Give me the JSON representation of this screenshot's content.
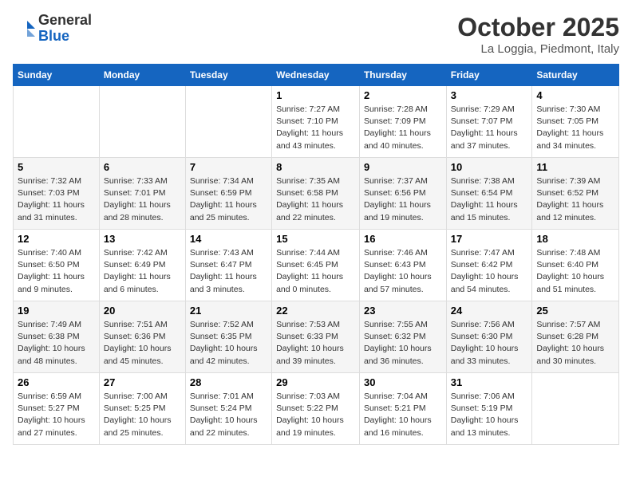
{
  "header": {
    "logo_general": "General",
    "logo_blue": "Blue",
    "month_title": "October 2025",
    "location": "La Loggia, Piedmont, Italy"
  },
  "weekdays": [
    "Sunday",
    "Monday",
    "Tuesday",
    "Wednesday",
    "Thursday",
    "Friday",
    "Saturday"
  ],
  "weeks": [
    [
      {
        "day": "",
        "text": ""
      },
      {
        "day": "",
        "text": ""
      },
      {
        "day": "",
        "text": ""
      },
      {
        "day": "1",
        "text": "Sunrise: 7:27 AM\nSunset: 7:10 PM\nDaylight: 11 hours and 43 minutes."
      },
      {
        "day": "2",
        "text": "Sunrise: 7:28 AM\nSunset: 7:09 PM\nDaylight: 11 hours and 40 minutes."
      },
      {
        "day": "3",
        "text": "Sunrise: 7:29 AM\nSunset: 7:07 PM\nDaylight: 11 hours and 37 minutes."
      },
      {
        "day": "4",
        "text": "Sunrise: 7:30 AM\nSunset: 7:05 PM\nDaylight: 11 hours and 34 minutes."
      }
    ],
    [
      {
        "day": "5",
        "text": "Sunrise: 7:32 AM\nSunset: 7:03 PM\nDaylight: 11 hours and 31 minutes."
      },
      {
        "day": "6",
        "text": "Sunrise: 7:33 AM\nSunset: 7:01 PM\nDaylight: 11 hours and 28 minutes."
      },
      {
        "day": "7",
        "text": "Sunrise: 7:34 AM\nSunset: 6:59 PM\nDaylight: 11 hours and 25 minutes."
      },
      {
        "day": "8",
        "text": "Sunrise: 7:35 AM\nSunset: 6:58 PM\nDaylight: 11 hours and 22 minutes."
      },
      {
        "day": "9",
        "text": "Sunrise: 7:37 AM\nSunset: 6:56 PM\nDaylight: 11 hours and 19 minutes."
      },
      {
        "day": "10",
        "text": "Sunrise: 7:38 AM\nSunset: 6:54 PM\nDaylight: 11 hours and 15 minutes."
      },
      {
        "day": "11",
        "text": "Sunrise: 7:39 AM\nSunset: 6:52 PM\nDaylight: 11 hours and 12 minutes."
      }
    ],
    [
      {
        "day": "12",
        "text": "Sunrise: 7:40 AM\nSunset: 6:50 PM\nDaylight: 11 hours and 9 minutes."
      },
      {
        "day": "13",
        "text": "Sunrise: 7:42 AM\nSunset: 6:49 PM\nDaylight: 11 hours and 6 minutes."
      },
      {
        "day": "14",
        "text": "Sunrise: 7:43 AM\nSunset: 6:47 PM\nDaylight: 11 hours and 3 minutes."
      },
      {
        "day": "15",
        "text": "Sunrise: 7:44 AM\nSunset: 6:45 PM\nDaylight: 11 hours and 0 minutes."
      },
      {
        "day": "16",
        "text": "Sunrise: 7:46 AM\nSunset: 6:43 PM\nDaylight: 10 hours and 57 minutes."
      },
      {
        "day": "17",
        "text": "Sunrise: 7:47 AM\nSunset: 6:42 PM\nDaylight: 10 hours and 54 minutes."
      },
      {
        "day": "18",
        "text": "Sunrise: 7:48 AM\nSunset: 6:40 PM\nDaylight: 10 hours and 51 minutes."
      }
    ],
    [
      {
        "day": "19",
        "text": "Sunrise: 7:49 AM\nSunset: 6:38 PM\nDaylight: 10 hours and 48 minutes."
      },
      {
        "day": "20",
        "text": "Sunrise: 7:51 AM\nSunset: 6:36 PM\nDaylight: 10 hours and 45 minutes."
      },
      {
        "day": "21",
        "text": "Sunrise: 7:52 AM\nSunset: 6:35 PM\nDaylight: 10 hours and 42 minutes."
      },
      {
        "day": "22",
        "text": "Sunrise: 7:53 AM\nSunset: 6:33 PM\nDaylight: 10 hours and 39 minutes."
      },
      {
        "day": "23",
        "text": "Sunrise: 7:55 AM\nSunset: 6:32 PM\nDaylight: 10 hours and 36 minutes."
      },
      {
        "day": "24",
        "text": "Sunrise: 7:56 AM\nSunset: 6:30 PM\nDaylight: 10 hours and 33 minutes."
      },
      {
        "day": "25",
        "text": "Sunrise: 7:57 AM\nSunset: 6:28 PM\nDaylight: 10 hours and 30 minutes."
      }
    ],
    [
      {
        "day": "26",
        "text": "Sunrise: 6:59 AM\nSunset: 5:27 PM\nDaylight: 10 hours and 27 minutes."
      },
      {
        "day": "27",
        "text": "Sunrise: 7:00 AM\nSunset: 5:25 PM\nDaylight: 10 hours and 25 minutes."
      },
      {
        "day": "28",
        "text": "Sunrise: 7:01 AM\nSunset: 5:24 PM\nDaylight: 10 hours and 22 minutes."
      },
      {
        "day": "29",
        "text": "Sunrise: 7:03 AM\nSunset: 5:22 PM\nDaylight: 10 hours and 19 minutes."
      },
      {
        "day": "30",
        "text": "Sunrise: 7:04 AM\nSunset: 5:21 PM\nDaylight: 10 hours and 16 minutes."
      },
      {
        "day": "31",
        "text": "Sunrise: 7:06 AM\nSunset: 5:19 PM\nDaylight: 10 hours and 13 minutes."
      },
      {
        "day": "",
        "text": ""
      }
    ]
  ]
}
